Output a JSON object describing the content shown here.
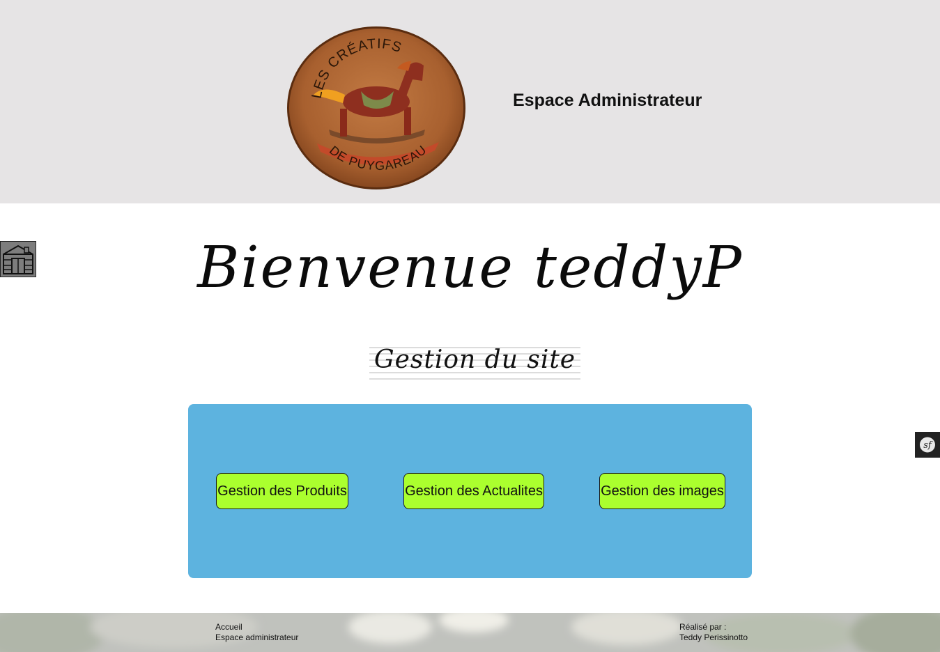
{
  "header": {
    "logo": {
      "text_top": "LES CRÉATIFS",
      "text_bottom": "DE PUYGAREAU"
    },
    "title": "Espace Administrateur"
  },
  "home_button": {
    "icon": "home-icon"
  },
  "main": {
    "welcome": "Bienvenue teddyP",
    "section_title": "Gestion du site",
    "buttons": [
      {
        "label": "Gestion des Produits"
      },
      {
        "label": "Gestion des Actualites"
      },
      {
        "label": "Gestion des images"
      }
    ]
  },
  "debug_toolbar": {
    "icon": "symfony-icon",
    "glyph": "sf"
  },
  "footer": {
    "links": [
      "Accueil",
      "Espace administrateur"
    ],
    "credit_label": "Réalisé par :",
    "credit_name": "Teddy Perissinotto"
  },
  "colors": {
    "header_bg": "#e6e4e5",
    "panel_bg": "#5db3df",
    "button_bg": "#abff2e",
    "home_bg": "#7d7d7d"
  }
}
